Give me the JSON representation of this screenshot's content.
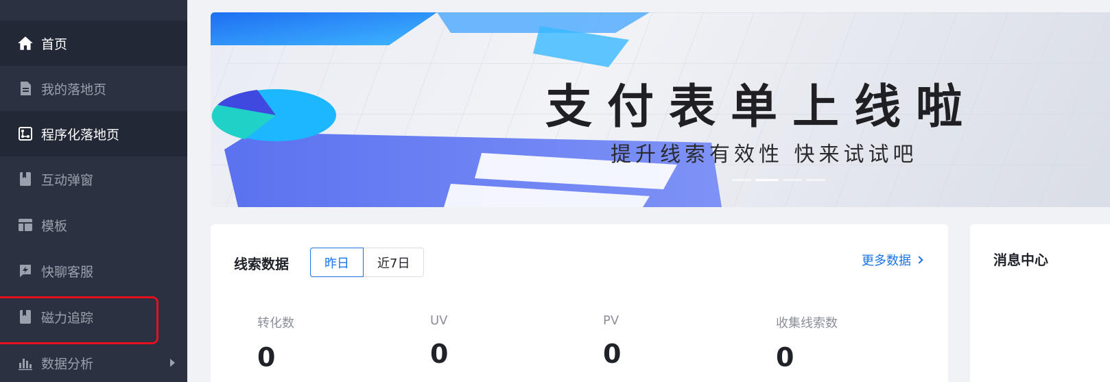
{
  "sidebar": {
    "items": [
      {
        "label": "首页",
        "icon": "home-icon",
        "active": true
      },
      {
        "label": "我的落地页",
        "icon": "document-icon",
        "active": false
      },
      {
        "label": "程序化落地页",
        "icon": "flow-icon",
        "active": true
      },
      {
        "label": "互动弹窗",
        "icon": "bookmark-icon",
        "active": false
      },
      {
        "label": "模板",
        "icon": "template-icon",
        "active": false
      },
      {
        "label": "快聊客服",
        "icon": "chat-bolt-icon",
        "active": false
      },
      {
        "label": "磁力追踪",
        "icon": "bookmark-icon",
        "active": false
      },
      {
        "label": "数据分析",
        "icon": "bar-chart-icon",
        "active": false
      }
    ]
  },
  "banner": {
    "title": "支付表单上线啦",
    "subtitle": "提升线索有效性 快来试试吧"
  },
  "leads": {
    "title": "线索数据",
    "ranges": [
      "昨日",
      "近7日"
    ],
    "selected_range": "昨日",
    "more_label": "更多数据",
    "metrics": [
      {
        "label": "转化数",
        "value": "0"
      },
      {
        "label": "UV",
        "value": "0"
      },
      {
        "label": "PV",
        "value": "0"
      },
      {
        "label": "收集线索数",
        "value": "0"
      }
    ]
  },
  "messages": {
    "title": "消息中心"
  },
  "colors": {
    "sidebar_bg": "#2b3140",
    "sidebar_active_bg": "#222836",
    "accent": "#1a73e8",
    "highlight_border": "#e8101c"
  }
}
